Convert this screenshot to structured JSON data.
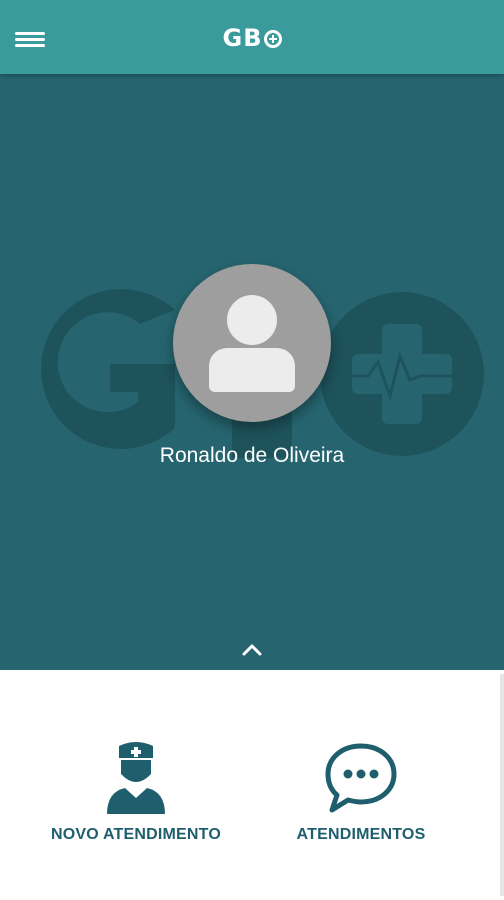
{
  "app_bar": {
    "logo_text": "GB",
    "menu_icon": "hamburger-menu-icon",
    "background": "#3a9a9c"
  },
  "profile": {
    "user_name": "Ronaldo de Oliveira",
    "avatar_icon": "user-avatar-icon",
    "watermark_logo": "GBO-cross-logo",
    "background": "#266570",
    "collapse_icon": "chevron-up-icon"
  },
  "actions": [
    {
      "label": "NOVO ATENDIMENTO",
      "icon": "nurse-icon"
    },
    {
      "label": "ATENDIMENTOS",
      "icon": "chat-bubble-icon"
    }
  ],
  "colors": {
    "accent": "#1f5f6d",
    "text_light": "#ffffff"
  }
}
